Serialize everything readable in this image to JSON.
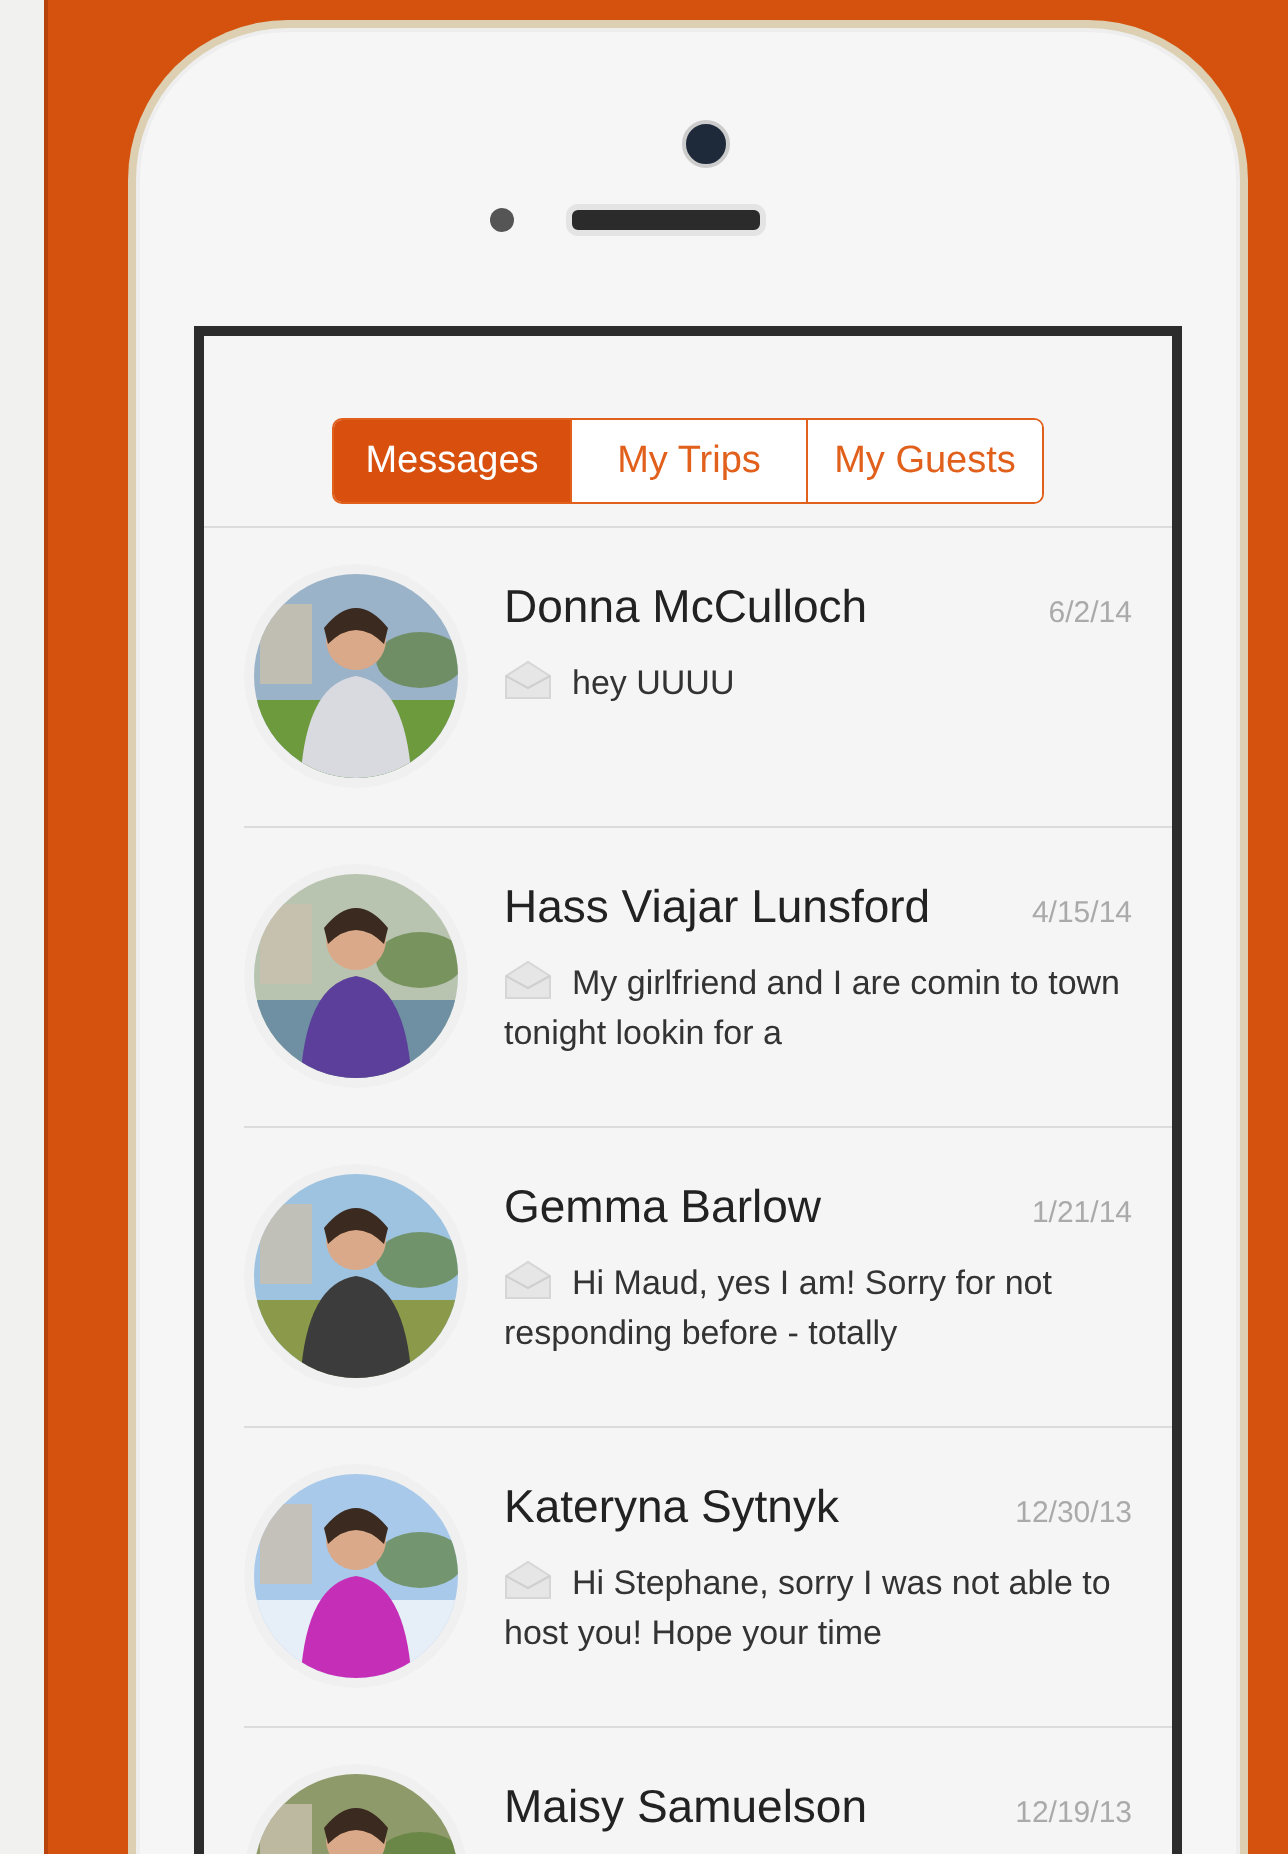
{
  "tabs": [
    {
      "label": "Messages",
      "selected": true
    },
    {
      "label": "My Trips",
      "selected": false
    },
    {
      "label": "My Guests",
      "selected": false
    }
  ],
  "conversations": [
    {
      "name": "Donna McCulloch",
      "date": "6/2/14",
      "preview": "hey UUUU"
    },
    {
      "name": "Hass Viajar Lunsford",
      "date": "4/15/14",
      "preview": "My girlfriend and I are comin to town tonight lookin for a"
    },
    {
      "name": "Gemma Barlow",
      "date": "1/21/14",
      "preview": "Hi Maud, yes I am! Sorry for not responding before - totally"
    },
    {
      "name": "Kateryna Sytnyk",
      "date": "12/30/13",
      "preview": "Hi Stephane, sorry I was not able to host you! Hope your time"
    },
    {
      "name": "Maisy Samuelson",
      "date": "12/19/13"
    }
  ]
}
